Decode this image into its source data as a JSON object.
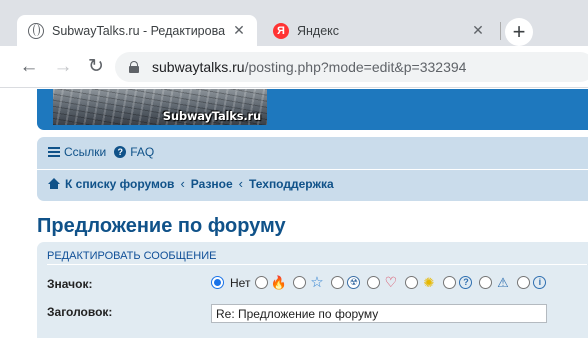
{
  "browser": {
    "tabs": [
      {
        "title": "SubwayTalks.ru - Редактировать",
        "active": true
      },
      {
        "title": "Яндекс",
        "active": false
      }
    ],
    "yandex_glyph": "Я",
    "new_tab": "+",
    "url_host": "subwaytalks.ru",
    "url_path": "/posting.php?mode=edit&p=332394",
    "back": "←",
    "forward": "→",
    "reload": "↻",
    "close": "✕"
  },
  "site": {
    "logo_text": "SubwayTalks.ru",
    "nav": {
      "faq_label": "Ссылки",
      "faq2_label": "FAQ",
      "faq_q": "?"
    },
    "breadcrumbs": [
      "К списку форумов",
      "Разное",
      "Техподдержка"
    ],
    "crumb_sep": "‹"
  },
  "form": {
    "page_title": "Предложение по форуму",
    "panel_title": "Редактировать сообщение",
    "icon_label": "Значок:",
    "none_label": "Нет",
    "subject_label": "Заголовок:",
    "subject_value": "Re: Предложение по форуму",
    "post_icons": [
      "fire-icon",
      "star-icon",
      "radioactive-icon",
      "heart-icon",
      "lightbulb-icon",
      "question-icon",
      "warning-icon",
      "info-icon"
    ],
    "glyphs": {
      "fire": "🔥",
      "star": "☆",
      "rad": "☢",
      "heart": "♡",
      "bulb": "✺",
      "quest": "?",
      "warn": "⚠",
      "info": "i"
    }
  },
  "colors": {
    "accent": "#1e78be",
    "link": "#105289",
    "navbar_bg": "#cadceb",
    "panel_bg": "#e1ebf2"
  }
}
